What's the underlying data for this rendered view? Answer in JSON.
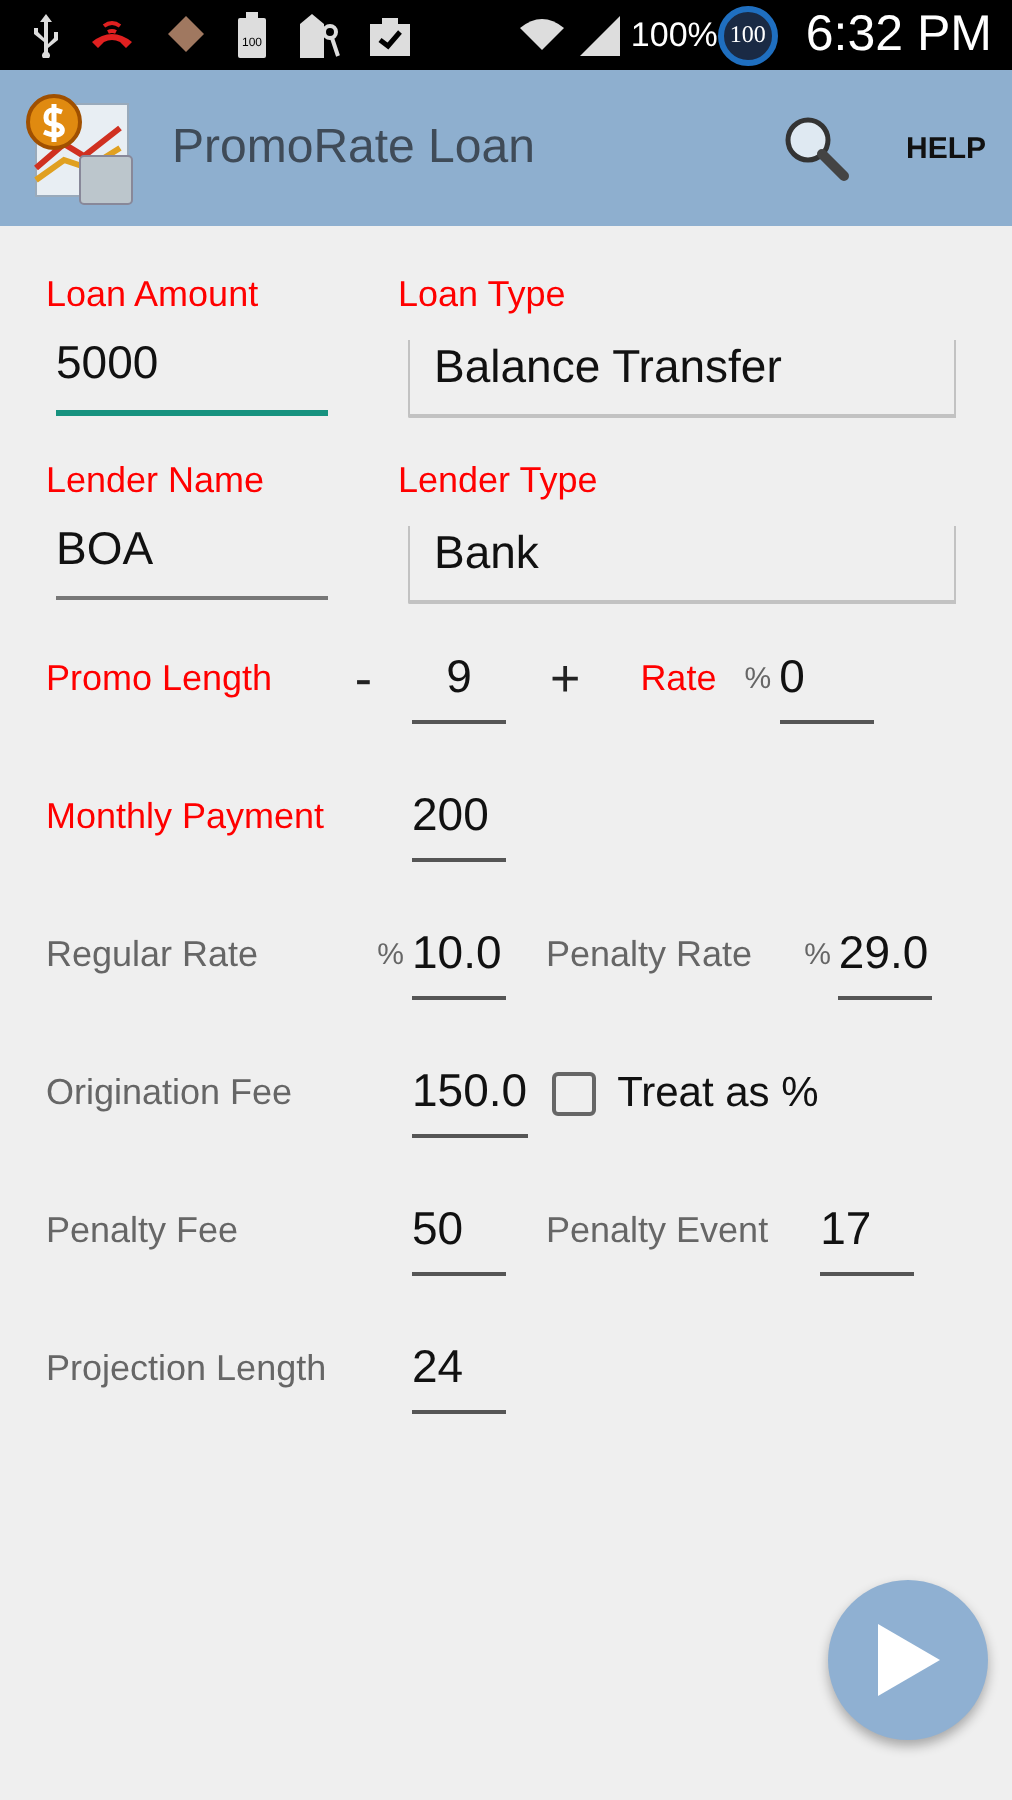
{
  "status_bar": {
    "storage_badge": "100",
    "battery_percent": "100%",
    "battery_circle": "100",
    "time": "6:32 PM"
  },
  "app_bar": {
    "title": "PromoRate Loan",
    "help": "HELP"
  },
  "top_rows": [
    [
      {
        "kind": "text",
        "label": "Loan Amount",
        "required": true,
        "value": "5000",
        "focused": true
      },
      {
        "kind": "dropdown",
        "label": "Loan Type",
        "required": true,
        "value": "Balance Transfer"
      }
    ],
    [
      {
        "kind": "text",
        "label": "Lender Name",
        "required": true,
        "value": "BOA",
        "focused": false
      },
      {
        "kind": "dropdown",
        "label": "Lender Type",
        "required": true,
        "value": "Bank"
      }
    ]
  ],
  "rows": [
    {
      "items": [
        {
          "kind": "stepper",
          "label": "Promo Length",
          "required": true,
          "minus": "-",
          "value": "9",
          "plus": "+"
        },
        {
          "kind": "field",
          "label": "Rate",
          "required": true,
          "unit": "%",
          "value": "0"
        }
      ]
    },
    {
      "items": [
        {
          "kind": "field",
          "label": "Monthly Payment",
          "required": true,
          "value": "200"
        }
      ]
    },
    {
      "items": [
        {
          "kind": "field",
          "label": "Regular Rate",
          "required": false,
          "unit": "%",
          "value": "10.0"
        },
        {
          "kind": "field",
          "label": "Penalty Rate",
          "required": false,
          "unit": "%",
          "value": "29.0"
        }
      ]
    },
    {
      "items": [
        {
          "kind": "field",
          "label": "Origination Fee",
          "required": false,
          "value": "150.0"
        },
        {
          "kind": "checkbox",
          "label": "Treat as %",
          "checked": false
        }
      ]
    },
    {
      "items": [
        {
          "kind": "field",
          "label": "Penalty Fee",
          "required": false,
          "value": "50"
        },
        {
          "kind": "field",
          "label": "Penalty Event",
          "required": false,
          "value": "17"
        }
      ]
    },
    {
      "items": [
        {
          "kind": "field",
          "label": "Projection Length",
          "required": false,
          "value": "24"
        }
      ]
    }
  ]
}
